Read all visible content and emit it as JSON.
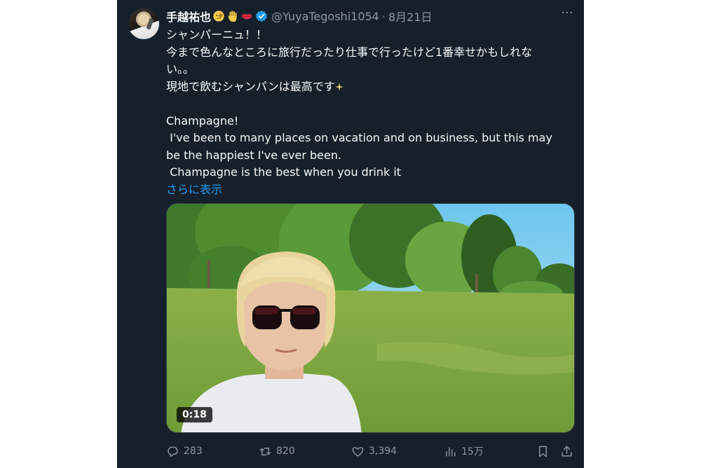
{
  "tweet": {
    "display_name": "手越祐也",
    "handle": "@YuyaTegoshi1054",
    "separator": "·",
    "date": "8月21日",
    "more_glyph": "···",
    "text_lines": [
      "シャンパーニュ！！",
      "今まで色んなところに旅行だったり仕事で行ったけど1番幸せかもしれな",
      "い。。",
      "現地で飲むシャンパンは最高です"
    ],
    "english_lines": [
      "Champagne!",
      " I've been to many places on vacation and on business, but this may",
      "be the happiest I've ever been.",
      " Champagne is the best when you drink it"
    ],
    "show_more": "さらに表示",
    "video": {
      "duration": "0:18"
    }
  },
  "actions": {
    "replies": "283",
    "retweets": "820",
    "likes": "3,394",
    "views": "15万"
  },
  "colors": {
    "background": "#15202b",
    "text": "#f7f9f9",
    "muted": "#8b98a5",
    "link": "#1d9bf0",
    "verified": "#1d9bf0"
  },
  "icons": [
    "monocle-face-icon",
    "raised-hand-icon",
    "lips-icon",
    "verified-badge-icon",
    "more-icon",
    "sparkle-icon",
    "reply-icon",
    "retweet-icon",
    "like-icon",
    "views-icon",
    "bookmark-icon",
    "share-icon"
  ]
}
